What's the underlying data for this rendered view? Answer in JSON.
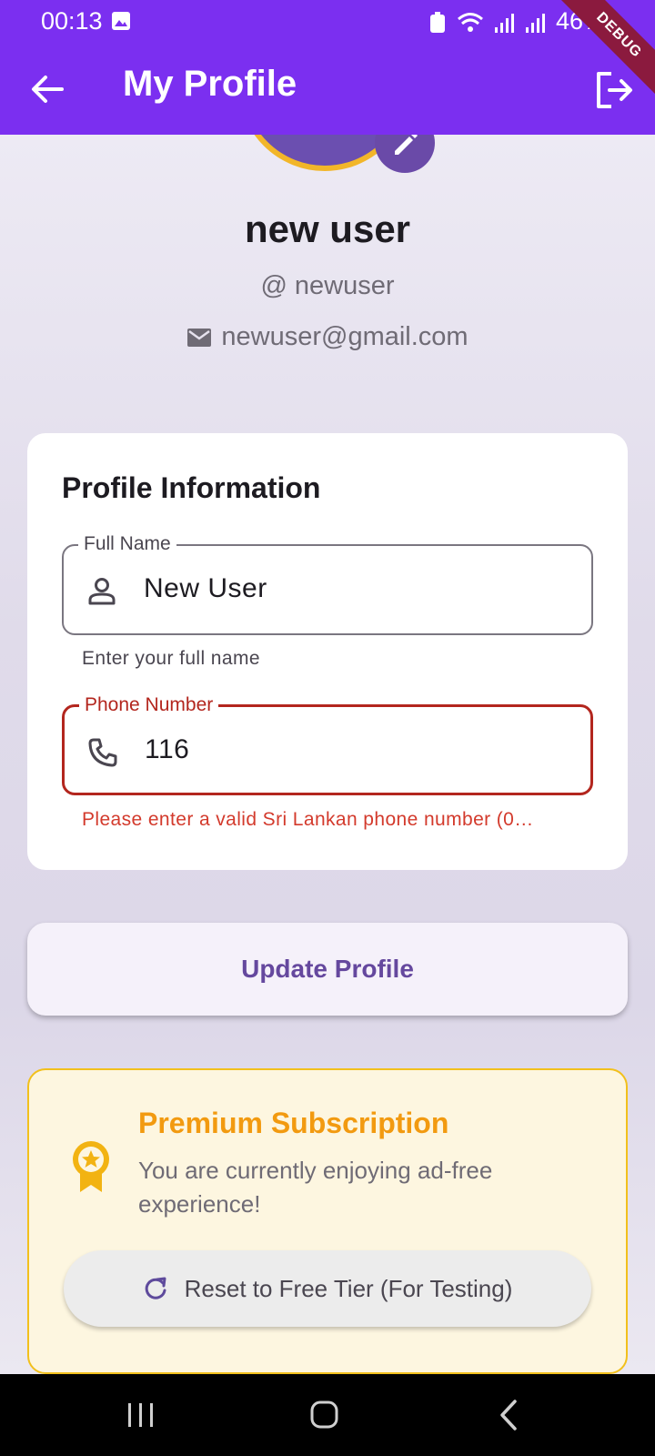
{
  "status_bar": {
    "time": "00:13",
    "battery": "46%"
  },
  "app_bar": {
    "title": "My Profile",
    "debug_label": "DEBUG"
  },
  "profile": {
    "name": "new user",
    "username": "@ newuser",
    "email": "newuser@gmail.com"
  },
  "profile_card": {
    "title": "Profile Information",
    "full_name": {
      "label": "Full Name",
      "value": "New User",
      "helper": "Enter your full name"
    },
    "phone": {
      "label": "Phone Number",
      "value": "116",
      "error": "Please enter a valid Sri Lankan phone number (0…"
    }
  },
  "update_button": {
    "label": "Update Profile"
  },
  "premium": {
    "title": "Premium Subscription",
    "description": "You are currently enjoying ad-free experience!",
    "reset_label": "Reset to Free Tier (For Testing)"
  },
  "colors": {
    "primary": "#7b2ff0",
    "error": "#b3261e",
    "premium_accent": "#f29a10",
    "button_text": "#65489e"
  },
  "icons": [
    "image-icon",
    "wifi-icon",
    "signal-icon",
    "battery-icon",
    "back-arrow-icon",
    "logout-icon",
    "edit-icon",
    "at-icon",
    "email-icon",
    "person-icon",
    "phone-icon",
    "award-icon",
    "refresh-icon",
    "recent-apps-icon",
    "home-icon",
    "nav-back-icon"
  ]
}
